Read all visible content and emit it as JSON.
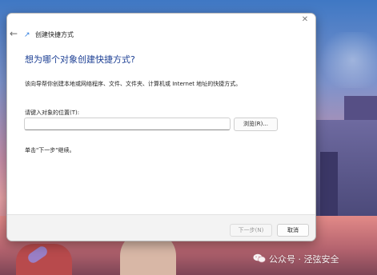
{
  "dialog": {
    "title": "创建快捷方式",
    "close_icon": "close-icon",
    "back_icon": "back-arrow-icon",
    "heading": "想为哪个对象创建快捷方式?",
    "description": "该向导帮你创建本地或网络程序、文件、文件夹、计算机或 Internet 地址的快捷方式。",
    "location_label": "请键入对象的位置(T):",
    "location_value": "",
    "location_placeholder": "",
    "browse_label": "浏览(R)...",
    "hint": "单击\"下一步\"继续。",
    "next_label": "下一步(N)",
    "cancel_label": "取消"
  },
  "watermark": {
    "text": "公众号 · 泾弦安全"
  },
  "colors": {
    "heading": "#1c3f94",
    "dialog_bg": "#ffffff",
    "footer_bg": "#f3f3f3"
  }
}
